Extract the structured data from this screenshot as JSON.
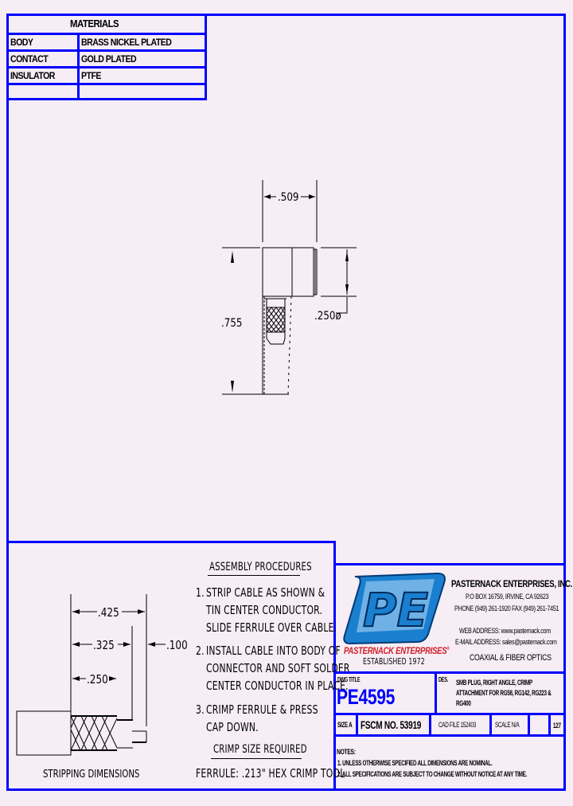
{
  "materials": {
    "title": "MATERIALS",
    "rows": [
      {
        "part": "BODY",
        "material": "BRASS NICKEL PLATED"
      },
      {
        "part": "CONTACT",
        "material": "GOLD PLATED"
      },
      {
        "part": "INSULATOR",
        "material": "PTFE"
      },
      {
        "part": "",
        "material": ""
      }
    ]
  },
  "main_drawing": {
    "dim_width": ".509",
    "dim_height": ".755",
    "dim_diameter": ".250ø"
  },
  "stripping": {
    "dim_1": ".425",
    "dim_2": ".325",
    "dim_3": ".250",
    "dim_4": ".100",
    "caption": "STRIPPING  DIMENSIONS"
  },
  "assembly": {
    "title": "ASSEMBLY  PROCEDURES",
    "steps": [
      {
        "num": "1.",
        "lines": [
          "STRIP  CABLE  AS  SHOWN  &",
          "TIN  CENTER  CONDUCTOR.",
          "SLIDE  FERRULE  OVER  CABLE."
        ]
      },
      {
        "num": "2.",
        "lines": [
          "INSTALL  CABLE  INTO  BODY  OF",
          "CONNECTOR  AND  SOFT  SOLDER",
          "CENTER  CONDUCTOR  IN  PLACE."
        ]
      },
      {
        "num": "3.",
        "lines": [
          "CRIMP  FERRULE  &  PRESS",
          "CAP  DOWN."
        ]
      }
    ],
    "crimp_title": "CRIMP  SIZE  REQUIRED",
    "crimp_text": "FERRULE:  .213\"  HEX  CRIMP  TOOL"
  },
  "company": {
    "logo_text": "PE",
    "logo_name": "PASTERNACK ENTERPRISES",
    "logo_reg": "®",
    "established": "ESTABLISHED 1972",
    "name": "PASTERNACK ENTERPRISES, INC.",
    "address": "P.O BOX 16759, IRVINE, CA 92623",
    "phone": "PHONE (949) 261-1920 FAX (949) 261-7451",
    "web": "WEB ADDRESS: www.pasternack.com",
    "email": "E-MAIL ADDRESS: sales@pasternack.com",
    "tagline": "COAXIAL & FIBER OPTICS",
    "colors": {
      "logo_blue": "#1a7fcf",
      "logo_light": "#6fb1e6",
      "logo_red": "#d0202a",
      "frame_blue": "#0000ff",
      "part_blue": "#0000ff"
    }
  },
  "title_block": {
    "dwg_title_label": "DWG TITLE",
    "part_number": "PE4595",
    "des_label": "DES.",
    "description": [
      "SMB PLUG, RIGHT ANGLE, CRIMP",
      "ATTACHMENT FOR RG58, RG142, RG223 &",
      "RG400"
    ],
    "size": "SIZE A",
    "fscm": "FSCM NO.  53919",
    "cad_file": "CAD FILE   152403",
    "scale": "SCALE  N/A",
    "blank": "",
    "sheet": "127"
  },
  "notes": {
    "title": "NOTES:",
    "items": [
      "1.  UNLESS OTHERWISE SPECIFIED ALL DIMENSIONS ARE NOMINAL.",
      "2.  ALL SPECIFICATIONS ARE SUBJECT TO CHANGE WITHOUT NOTICE AT ANY TIME."
    ]
  }
}
